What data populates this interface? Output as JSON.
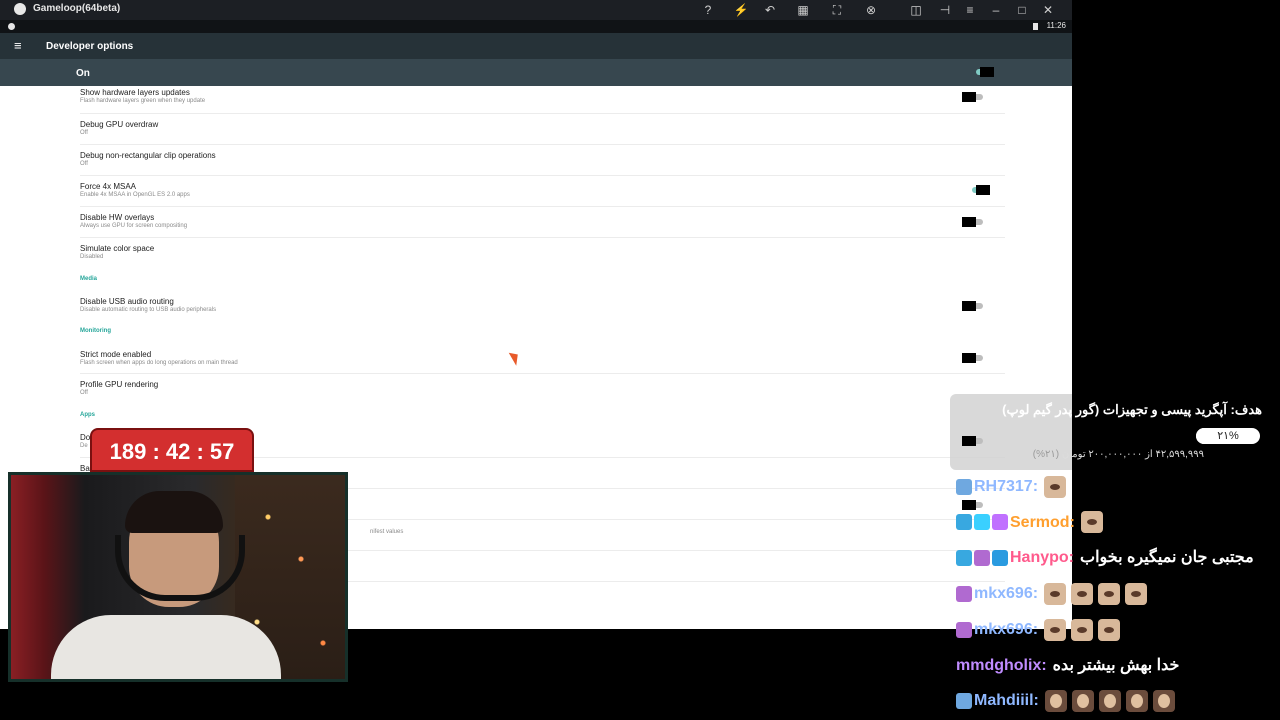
{
  "window": {
    "title": "Gameloop(64beta)",
    "toolbar_icons": [
      "help-icon",
      "boost-icon",
      "back-icon",
      "keyboard-icon",
      "fullscreen-icon",
      "steering-icon",
      "sidebar-icon",
      "pin-icon",
      "menu-icon",
      "minimize-icon",
      "maximize-icon",
      "close-icon"
    ]
  },
  "statusbar": {
    "clock": "11:26"
  },
  "settings": {
    "title": "Developer options",
    "master_label": "On",
    "rows": [
      {
        "title": "Show hardware layers updates",
        "subtitle": "Flash hardware layers green when they update",
        "toggle": "off"
      },
      {
        "title": "Debug GPU overdraw",
        "subtitle": "Off",
        "toggle": null
      },
      {
        "title": "Debug non-rectangular clip operations",
        "subtitle": "Off",
        "toggle": null
      },
      {
        "title": "Force 4x MSAA",
        "subtitle": "Enable 4x MSAA in OpenGL ES 2.0 apps",
        "toggle": "on"
      },
      {
        "title": "Disable HW overlays",
        "subtitle": "Always use GPU for screen compositing",
        "toggle": "off"
      },
      {
        "title": "Simulate color space",
        "subtitle": "Disabled",
        "toggle": null
      },
      {
        "title": "Disable USB audio routing",
        "subtitle": "Disable automatic routing to USB audio peripherals",
        "toggle": "off"
      },
      {
        "title": "Strict mode enabled",
        "subtitle": "Flash screen when apps do long operations on main thread",
        "toggle": "off"
      },
      {
        "title": "Profile GPU rendering",
        "subtitle": "Off",
        "toggle": null
      }
    ],
    "categories": {
      "media": "Media",
      "monitoring": "Monitoring",
      "apps": "Apps"
    },
    "partial_rows": {
      "apps_first_title": "Do",
      "apps_first_sub": "De",
      "apps_second_title": "Ba",
      "manifest_fragment": "nifest values"
    }
  },
  "timer": {
    "text": "189 : 42 : 57"
  },
  "goal": {
    "title": "هدف: آپگرید پیسی و تجهیزات (گور پدر گیم لوپ)",
    "progress_label": "۲۱%",
    "progress_fraction": 0.21,
    "amount_text": "۴۲,۵۹۹,۹۹۹ از ۲۰۰,۰۰۰,۰۰۰ تومان",
    "amount_pct": "(۲۱%)"
  },
  "chat": [
    {
      "user": "RH7317:",
      "color": "#8fb8ff",
      "badges": [
        "#6fa8e0"
      ],
      "emotes": 1,
      "emote_kind": "cat",
      "text": ""
    },
    {
      "user": "Sermod:",
      "color": "#ff9f2e",
      "badges": [
        "#38a8e0",
        "#3ad0ff",
        "#c070ff"
      ],
      "emotes": 1,
      "emote_kind": "cat",
      "text": ""
    },
    {
      "user": "Hanypo:",
      "color": "#ff5a8c",
      "badges": [
        "#38a8e0",
        "#b06ad0",
        "#2a9be0"
      ],
      "emotes": 0,
      "emote_kind": "cat",
      "text": "مجتبی جان نمیگیره بخواب"
    },
    {
      "user": "mkx696:",
      "color": "#8fb8ff",
      "badges": [
        "#b06ad0"
      ],
      "emotes": 4,
      "emote_kind": "cat",
      "text": ""
    },
    {
      "user": "mkx696:",
      "color": "#8fb8ff",
      "badges": [
        "#b06ad0"
      ],
      "emotes": 3,
      "emote_kind": "cat",
      "text": ""
    },
    {
      "user": "mmdgholix:",
      "color": "#c08cff",
      "badges": [],
      "emotes": 0,
      "emote_kind": "cat",
      "text": "خدا بهش بیشتر بده"
    },
    {
      "user": "Mahdiiil:",
      "color": "#8fb8ff",
      "badges": [
        "#6fa8e0"
      ],
      "emotes": 5,
      "emote_kind": "face",
      "text": ""
    }
  ]
}
